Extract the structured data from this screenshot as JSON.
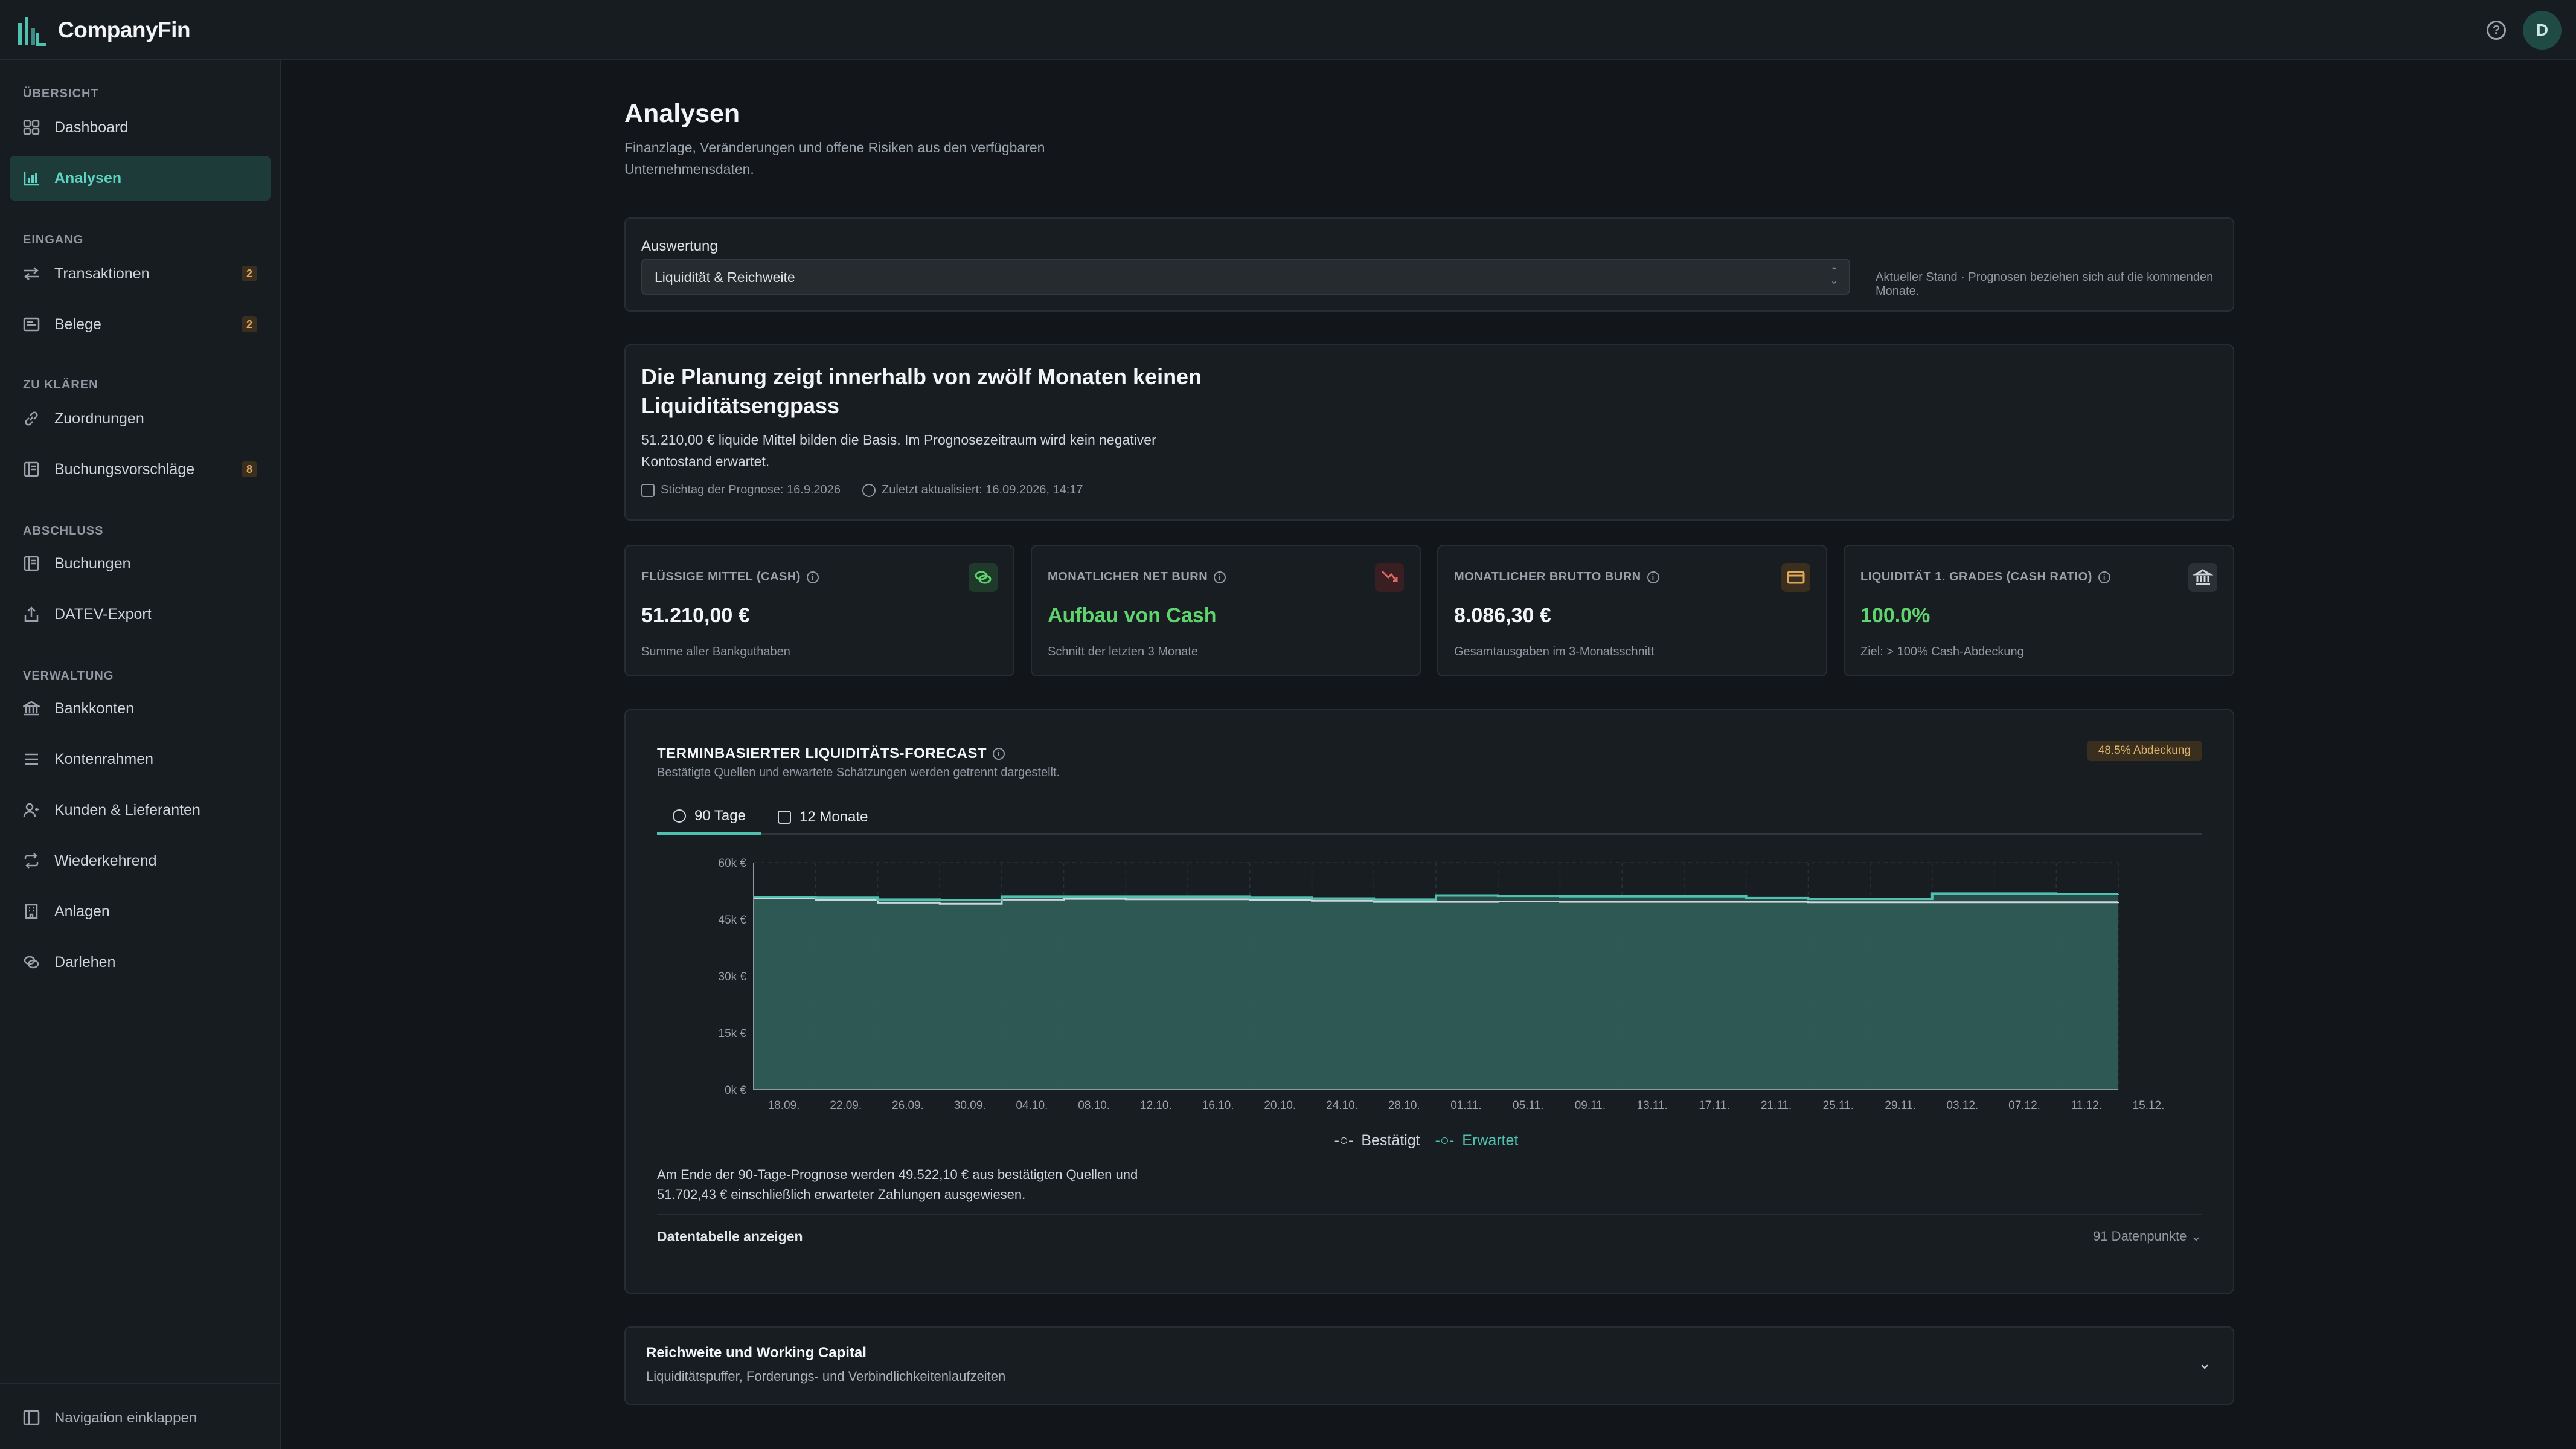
{
  "app": {
    "name": "CompanyFin",
    "user_initial": "D"
  },
  "sidebar": {
    "sections": [
      {
        "label": "ÜBERSICHT"
      },
      {
        "label": "EINGANG"
      },
      {
        "label": "ZU KLÄREN"
      },
      {
        "label": "ABSCHLUSS"
      },
      {
        "label": "VERWALTUNG"
      }
    ],
    "items": [
      {
        "label": "Dashboard",
        "icon": "grid-icon"
      },
      {
        "label": "Analysen",
        "icon": "bar-chart-icon",
        "active": true
      },
      {
        "label": "Transaktionen",
        "icon": "arrows-icon",
        "badge": "2"
      },
      {
        "label": "Belege",
        "icon": "receipt-icon",
        "badge": "2"
      },
      {
        "label": "Zuordnungen",
        "icon": "link-icon"
      },
      {
        "label": "Buchungsvorschläge",
        "icon": "ledger-icon",
        "badge": "8"
      },
      {
        "label": "Buchungen",
        "icon": "book-icon"
      },
      {
        "label": "DATEV-Export",
        "icon": "export-icon"
      },
      {
        "label": "Bankkonten",
        "icon": "bank-icon"
      },
      {
        "label": "Kontenrahmen",
        "icon": "list-icon"
      },
      {
        "label": "Kunden & Lieferanten",
        "icon": "users-icon"
      },
      {
        "label": "Wiederkehrend",
        "icon": "repeat-icon"
      },
      {
        "label": "Anlagen",
        "icon": "building-icon"
      },
      {
        "label": "Darlehen",
        "icon": "coins-icon"
      }
    ],
    "collapse_label": "Navigation einklappen"
  },
  "page": {
    "title": "Analysen",
    "subtitle": "Finanzlage, Veränderungen und offene Risiken aus den verfügbaren Unternehmensdaten."
  },
  "evaluation": {
    "label": "Auswertung",
    "value": "Liquidität & Reichweite",
    "note": "Aktueller Stand · Prognosen beziehen sich auf die kommenden Monate."
  },
  "summary": {
    "title": "Die Planung zeigt innerhalb von zwölf Monaten keinen Liquiditätsengpass",
    "text": "51.210,00 € liquide Mittel bilden die Basis. Im Prognosezeitraum wird kein negativer Kontostand erwartet.",
    "reference_date": "Stichtag der Prognose: 16.9.2026",
    "updated": "Zuletzt aktualisiert: 16.09.2026, 14:17"
  },
  "kpis": [
    {
      "label": "FLÜSSIGE MITTEL (CASH)",
      "value": "51.210,00 €",
      "sub": "Summe aller Bankguthaben",
      "icon": "coins-icon",
      "accent": "#5fd46e"
    },
    {
      "label": "MONATLICHER NET BURN",
      "value": "Aufbau von Cash",
      "sub": "Schnitt der letzten 3 Monate",
      "icon": "trend-down-icon",
      "accent": "#e06565"
    },
    {
      "label": "MONATLICHER BRUTTO BURN",
      "value": "8.086,30 €",
      "sub": "Gesamtausgaben im 3-Monatsschnitt",
      "icon": "card-icon",
      "accent": "#e0a85a"
    },
    {
      "label": "LIQUIDITÄT 1. GRADES (CASH RATIO)",
      "value": "100.0%",
      "sub": "Ziel: > 100% Cash-Abdeckung",
      "icon": "bank-icon",
      "accent": "#cfd5da"
    }
  ],
  "forecast": {
    "title": "TERMINBASIERTER LIQUIDITÄTS-FORECAST",
    "subtitle": "Bestätigte Quellen und erwartete Schätzungen werden getrennt dargestellt.",
    "coverage_badge": "48.5% Abdeckung",
    "tabs": [
      {
        "label": "90 Tage",
        "active": true
      },
      {
        "label": "12 Monate"
      }
    ],
    "text": "Am Ende der 90-Tage-Prognose werden 49.522,10 € aus bestätigten Quellen und 51.702,43 € einschließlich erwarteter Zahlungen ausgewiesen.",
    "table_toggle": "Datentabelle anzeigen",
    "points": "91 Datenpunkte",
    "legend_confirmed": "Bestätigt",
    "legend_expected": "Erwartet"
  },
  "chart_data": {
    "type": "area",
    "x": [
      "18.09.",
      "22.09.",
      "26.09.",
      "30.09.",
      "04.10.",
      "08.10.",
      "12.10.",
      "16.10.",
      "20.10.",
      "24.10.",
      "28.10.",
      "01.11.",
      "05.11.",
      "09.11.",
      "13.11.",
      "17.11.",
      "21.11.",
      "25.11.",
      "29.11.",
      "03.12.",
      "07.12.",
      "11.12.",
      "15.12."
    ],
    "yticks": [
      "0k €",
      "15k €",
      "30k €",
      "45k €",
      "60k €"
    ],
    "ylim": [
      0,
      60000
    ],
    "grid": true,
    "legend": "bottom",
    "series": [
      {
        "name": "Bestätigt",
        "color": "#cfd5da",
        "values": [
          50600,
          50100,
          49400,
          49100,
          50200,
          50400,
          50300,
          50300,
          50100,
          49900,
          49600,
          49600,
          49700,
          49600,
          49600,
          49600,
          49600,
          49500,
          49500,
          49500,
          49500,
          49500,
          49522
        ]
      },
      {
        "name": "Erwartet",
        "color": "#4fc1b1",
        "values": [
          50900,
          50700,
          50200,
          50100,
          51000,
          51000,
          51000,
          51000,
          50700,
          50500,
          50200,
          51300,
          51200,
          51100,
          51100,
          51100,
          50600,
          50400,
          50400,
          51800,
          51800,
          51700,
          51702
        ]
      }
    ]
  },
  "working_capital": {
    "title": "Reichweite und Working Capital",
    "subtitle": "Liquiditätspuffer, Forderungs- und Verbindlichkeitenlaufzeiten"
  }
}
